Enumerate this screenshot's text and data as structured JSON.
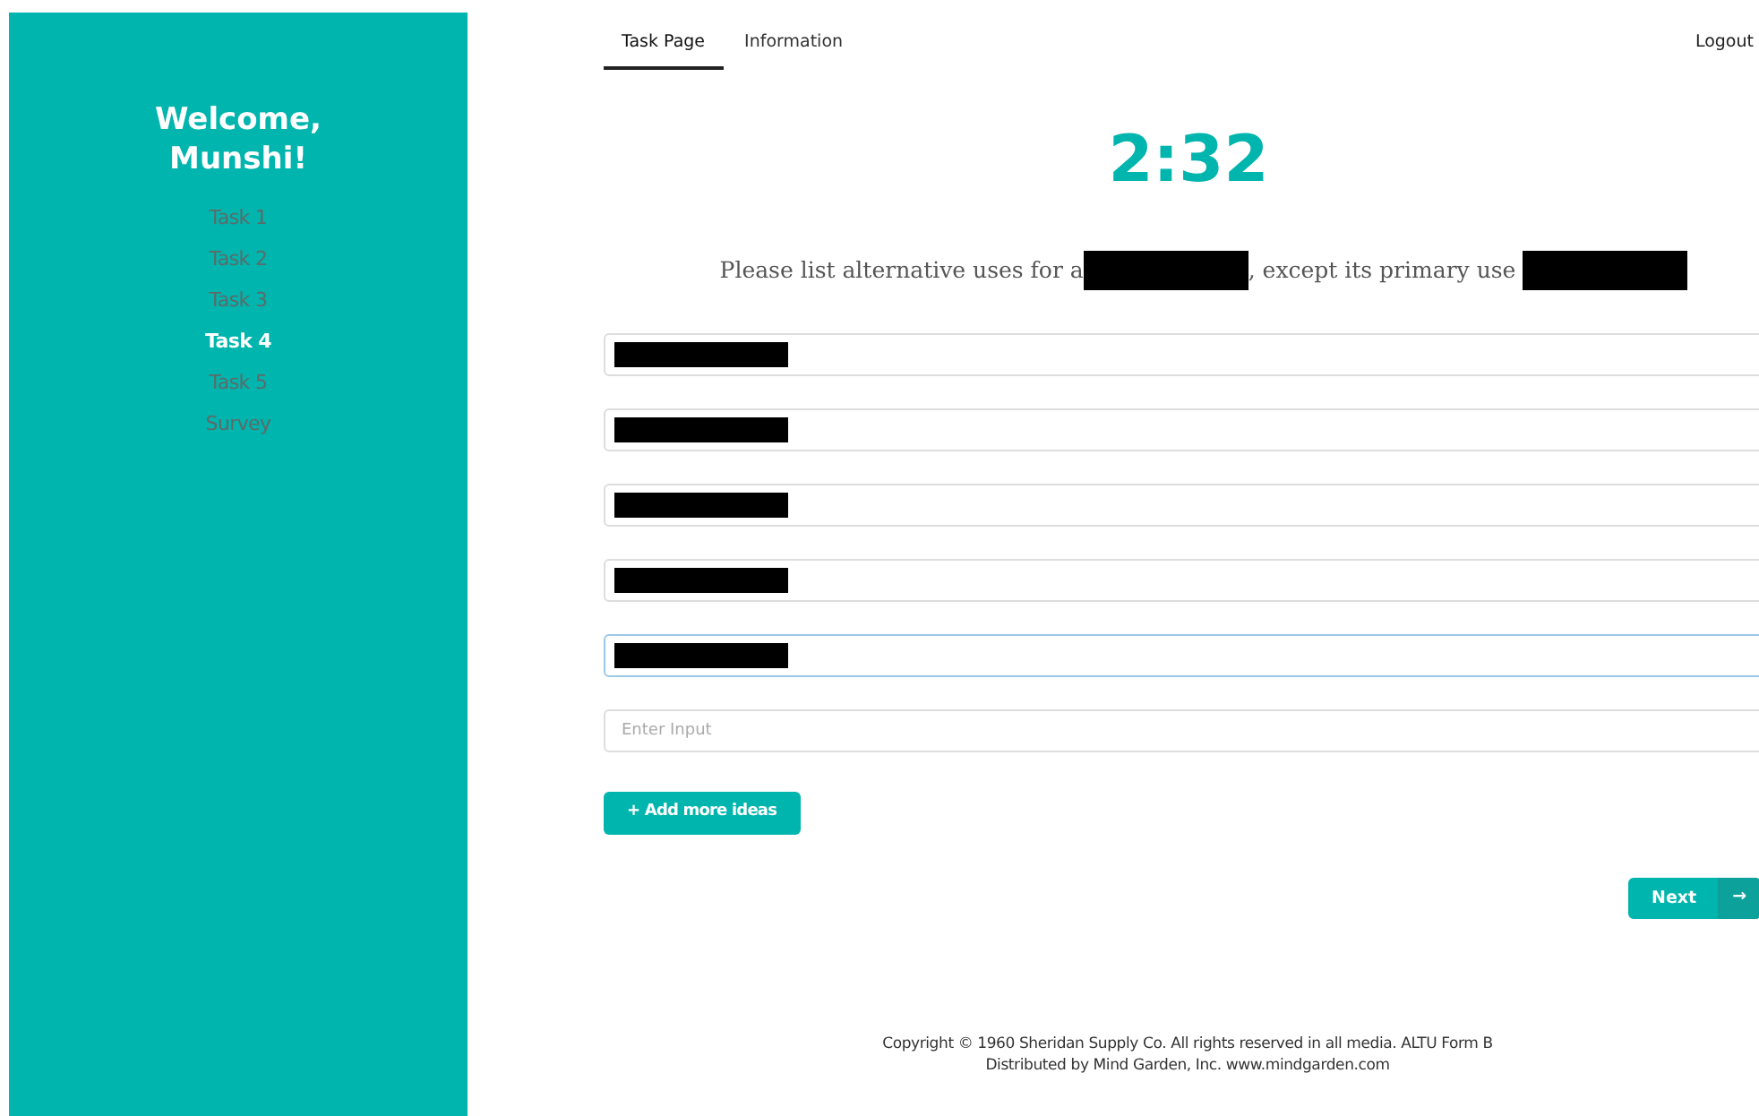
{
  "sidebar": {
    "title": "Welcome, Munshi!",
    "items": [
      {
        "label": "Task 1",
        "selected": false
      },
      {
        "label": "Task 2",
        "selected": false
      },
      {
        "label": "Task 3",
        "selected": false
      },
      {
        "label": "Task 4",
        "selected": true
      },
      {
        "label": "Task 5",
        "selected": false
      },
      {
        "label": "Survey",
        "selected": false
      }
    ]
  },
  "tabs": [
    {
      "label": "Task Page",
      "selected": true
    },
    {
      "label": "Information",
      "selected": false
    }
  ],
  "logout": "Logout",
  "timer": "2:32",
  "prompt": [
    {
      "kind": "text",
      "text": "Please list alternative uses for a"
    },
    {
      "kind": "redacted"
    },
    {
      "kind": "text",
      "text": ", except its primary use"
    },
    {
      "kind": "redacted"
    }
  ],
  "answers": [
    {
      "redacted": true,
      "focused": false
    },
    {
      "redacted": true,
      "focused": false
    },
    {
      "redacted": true,
      "focused": false
    },
    {
      "redacted": true,
      "focused": false
    },
    {
      "redacted": true,
      "focused": true
    },
    {
      "redacted": false,
      "focused": false,
      "placeholder": "Enter Input"
    }
  ],
  "add_button": "+ Add more ideas",
  "next_button": "Next",
  "arrow": "→",
  "footer": [
    "Copyright © 1960 Sheridan Supply Co. All rights reserved in all media. ALTU Form B",
    "Distributed by Mind Garden, Inc. www.mindgarden.com"
  ]
}
